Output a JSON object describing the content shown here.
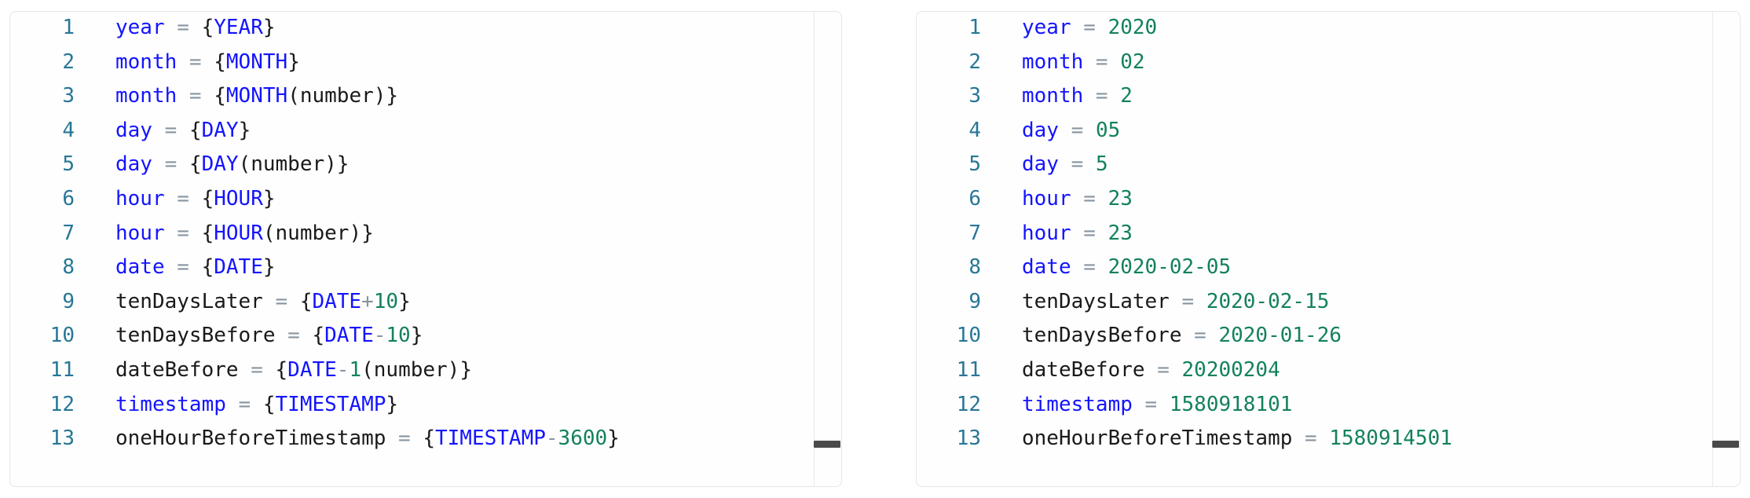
{
  "panels": [
    {
      "name": "template-panel",
      "lines": [
        {
          "n": "1",
          "tokens": [
            {
              "t": "year",
              "c": "key"
            },
            {
              "t": " = ",
              "c": "eq"
            },
            {
              "t": "{",
              "c": "brace"
            },
            {
              "t": "YEAR",
              "c": "macro"
            },
            {
              "t": "}",
              "c": "brace"
            }
          ]
        },
        {
          "n": "2",
          "tokens": [
            {
              "t": "month",
              "c": "key"
            },
            {
              "t": " = ",
              "c": "eq"
            },
            {
              "t": "{",
              "c": "brace"
            },
            {
              "t": "MONTH",
              "c": "macro"
            },
            {
              "t": "}",
              "c": "brace"
            }
          ]
        },
        {
          "n": "3",
          "tokens": [
            {
              "t": "month",
              "c": "key"
            },
            {
              "t": " = ",
              "c": "eq"
            },
            {
              "t": "{",
              "c": "brace"
            },
            {
              "t": "MONTH",
              "c": "macro"
            },
            {
              "t": "(number)",
              "c": "arg"
            },
            {
              "t": "}",
              "c": "brace"
            }
          ]
        },
        {
          "n": "4",
          "tokens": [
            {
              "t": "day",
              "c": "key"
            },
            {
              "t": " = ",
              "c": "eq"
            },
            {
              "t": "{",
              "c": "brace"
            },
            {
              "t": "DAY",
              "c": "macro"
            },
            {
              "t": "}",
              "c": "brace"
            }
          ]
        },
        {
          "n": "5",
          "tokens": [
            {
              "t": "day",
              "c": "key"
            },
            {
              "t": " = ",
              "c": "eq"
            },
            {
              "t": "{",
              "c": "brace"
            },
            {
              "t": "DAY",
              "c": "macro"
            },
            {
              "t": "(number)",
              "c": "arg"
            },
            {
              "t": "}",
              "c": "brace"
            }
          ]
        },
        {
          "n": "6",
          "tokens": [
            {
              "t": "hour",
              "c": "key"
            },
            {
              "t": " = ",
              "c": "eq"
            },
            {
              "t": "{",
              "c": "brace"
            },
            {
              "t": "HOUR",
              "c": "macro"
            },
            {
              "t": "}",
              "c": "brace"
            }
          ]
        },
        {
          "n": "7",
          "tokens": [
            {
              "t": "hour",
              "c": "key"
            },
            {
              "t": " = ",
              "c": "eq"
            },
            {
              "t": "{",
              "c": "brace"
            },
            {
              "t": "HOUR",
              "c": "macro"
            },
            {
              "t": "(number)",
              "c": "arg"
            },
            {
              "t": "}",
              "c": "brace"
            }
          ]
        },
        {
          "n": "8",
          "tokens": [
            {
              "t": "date",
              "c": "key"
            },
            {
              "t": " = ",
              "c": "eq"
            },
            {
              "t": "{",
              "c": "brace"
            },
            {
              "t": "DATE",
              "c": "macro"
            },
            {
              "t": "}",
              "c": "brace"
            }
          ]
        },
        {
          "n": "9",
          "tokens": [
            {
              "t": "tenDaysLater",
              "c": "plain"
            },
            {
              "t": " = ",
              "c": "eq"
            },
            {
              "t": "{",
              "c": "brace"
            },
            {
              "t": "DATE",
              "c": "macro"
            },
            {
              "t": "+",
              "c": "eq"
            },
            {
              "t": "10",
              "c": "num"
            },
            {
              "t": "}",
              "c": "brace"
            }
          ]
        },
        {
          "n": "10",
          "tokens": [
            {
              "t": "tenDaysBefore",
              "c": "plain"
            },
            {
              "t": " = ",
              "c": "eq"
            },
            {
              "t": "{",
              "c": "brace"
            },
            {
              "t": "DATE",
              "c": "macro"
            },
            {
              "t": "-",
              "c": "eq"
            },
            {
              "t": "10",
              "c": "num"
            },
            {
              "t": "}",
              "c": "brace"
            }
          ]
        },
        {
          "n": "11",
          "tokens": [
            {
              "t": "dateBefore",
              "c": "plain"
            },
            {
              "t": " = ",
              "c": "eq"
            },
            {
              "t": "{",
              "c": "brace"
            },
            {
              "t": "DATE",
              "c": "macro"
            },
            {
              "t": "-",
              "c": "eq"
            },
            {
              "t": "1",
              "c": "num"
            },
            {
              "t": "(number)",
              "c": "arg"
            },
            {
              "t": "}",
              "c": "brace"
            }
          ]
        },
        {
          "n": "12",
          "tokens": [
            {
              "t": "timestamp",
              "c": "key"
            },
            {
              "t": " = ",
              "c": "eq"
            },
            {
              "t": "{",
              "c": "brace"
            },
            {
              "t": "TIMESTAMP",
              "c": "macro"
            },
            {
              "t": "}",
              "c": "brace"
            }
          ]
        },
        {
          "n": "13",
          "tokens": [
            {
              "t": "oneHourBeforeTimestamp",
              "c": "plain"
            },
            {
              "t": " = ",
              "c": "eq"
            },
            {
              "t": "{",
              "c": "brace"
            },
            {
              "t": "TIMESTAMP",
              "c": "macro"
            },
            {
              "t": "-",
              "c": "eq"
            },
            {
              "t": "3600",
              "c": "num"
            },
            {
              "t": "}",
              "c": "brace"
            }
          ]
        }
      ]
    },
    {
      "name": "resolved-panel",
      "lines": [
        {
          "n": "1",
          "tokens": [
            {
              "t": "year",
              "c": "key"
            },
            {
              "t": " = ",
              "c": "eq"
            },
            {
              "t": "2020",
              "c": "num"
            }
          ]
        },
        {
          "n": "2",
          "tokens": [
            {
              "t": "month",
              "c": "key"
            },
            {
              "t": " = ",
              "c": "eq"
            },
            {
              "t": "02",
              "c": "num"
            }
          ]
        },
        {
          "n": "3",
          "tokens": [
            {
              "t": "month",
              "c": "key"
            },
            {
              "t": " = ",
              "c": "eq"
            },
            {
              "t": "2",
              "c": "num"
            }
          ]
        },
        {
          "n": "4",
          "tokens": [
            {
              "t": "day",
              "c": "key"
            },
            {
              "t": " = ",
              "c": "eq"
            },
            {
              "t": "05",
              "c": "num"
            }
          ]
        },
        {
          "n": "5",
          "tokens": [
            {
              "t": "day",
              "c": "key"
            },
            {
              "t": " = ",
              "c": "eq"
            },
            {
              "t": "5",
              "c": "num"
            }
          ]
        },
        {
          "n": "6",
          "tokens": [
            {
              "t": "hour",
              "c": "key"
            },
            {
              "t": " = ",
              "c": "eq"
            },
            {
              "t": "23",
              "c": "num"
            }
          ]
        },
        {
          "n": "7",
          "tokens": [
            {
              "t": "hour",
              "c": "key"
            },
            {
              "t": " = ",
              "c": "eq"
            },
            {
              "t": "23",
              "c": "num"
            }
          ]
        },
        {
          "n": "8",
          "tokens": [
            {
              "t": "date",
              "c": "key"
            },
            {
              "t": " = ",
              "c": "eq"
            },
            {
              "t": "2020-02-05",
              "c": "num"
            }
          ]
        },
        {
          "n": "9",
          "tokens": [
            {
              "t": "tenDaysLater",
              "c": "plain"
            },
            {
              "t": " = ",
              "c": "eq"
            },
            {
              "t": "2020-02-15",
              "c": "num"
            }
          ]
        },
        {
          "n": "10",
          "tokens": [
            {
              "t": "tenDaysBefore",
              "c": "plain"
            },
            {
              "t": " = ",
              "c": "eq"
            },
            {
              "t": "2020-01-26",
              "c": "num"
            }
          ]
        },
        {
          "n": "11",
          "tokens": [
            {
              "t": "dateBefore",
              "c": "plain"
            },
            {
              "t": " = ",
              "c": "eq"
            },
            {
              "t": "20200204",
              "c": "num"
            }
          ]
        },
        {
          "n": "12",
          "tokens": [
            {
              "t": "timestamp",
              "c": "key"
            },
            {
              "t": " = ",
              "c": "eq"
            },
            {
              "t": "1580918101",
              "c": "num"
            }
          ]
        },
        {
          "n": "13",
          "tokens": [
            {
              "t": "oneHourBeforeTimestamp",
              "c": "plain"
            },
            {
              "t": " = ",
              "c": "eq"
            },
            {
              "t": "1580914501",
              "c": "num"
            }
          ]
        }
      ]
    }
  ],
  "colors": {
    "line_number": "#277796",
    "key": "#1414ff",
    "macro": "#1414ff",
    "number": "#13815c",
    "operator": "#8795a1",
    "plain": "#1a1a1a",
    "panel_border": "#e6e6e6",
    "scrollbar_thumb": "#4a4a4a",
    "background": "#ffffff"
  }
}
